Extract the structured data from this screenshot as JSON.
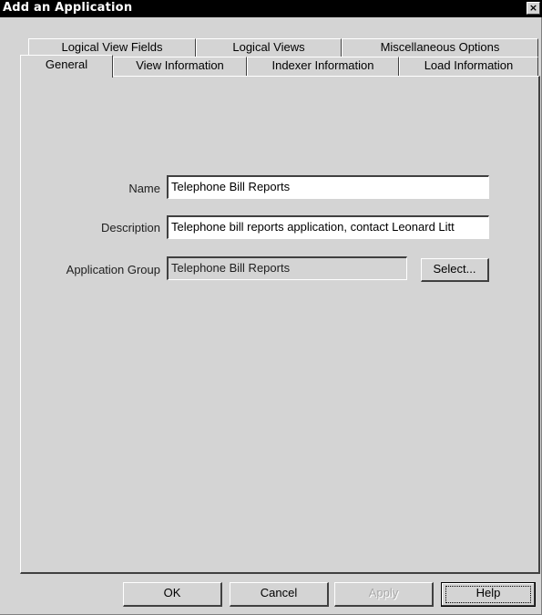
{
  "window": {
    "title": "Add an Application",
    "close_label": "×"
  },
  "tabs_back_row": [
    {
      "label": "Logical View Fields"
    },
    {
      "label": "Logical Views"
    },
    {
      "label": "Miscellaneous Options"
    }
  ],
  "tabs_front_row": [
    {
      "label": "General",
      "selected": true
    },
    {
      "label": "View Information"
    },
    {
      "label": "Indexer Information"
    },
    {
      "label": "Load Information"
    }
  ],
  "form": {
    "name_label": "Name",
    "name_value": "Telephone Bill Reports",
    "description_label": "Description",
    "description_value": "Telephone bill reports application, contact Leonard Litt",
    "group_label": "Application Group",
    "group_value": "Telephone Bill Reports",
    "select_label": "Select..."
  },
  "buttons": {
    "ok": "OK",
    "cancel": "Cancel",
    "apply": "Apply",
    "help": "Help"
  }
}
